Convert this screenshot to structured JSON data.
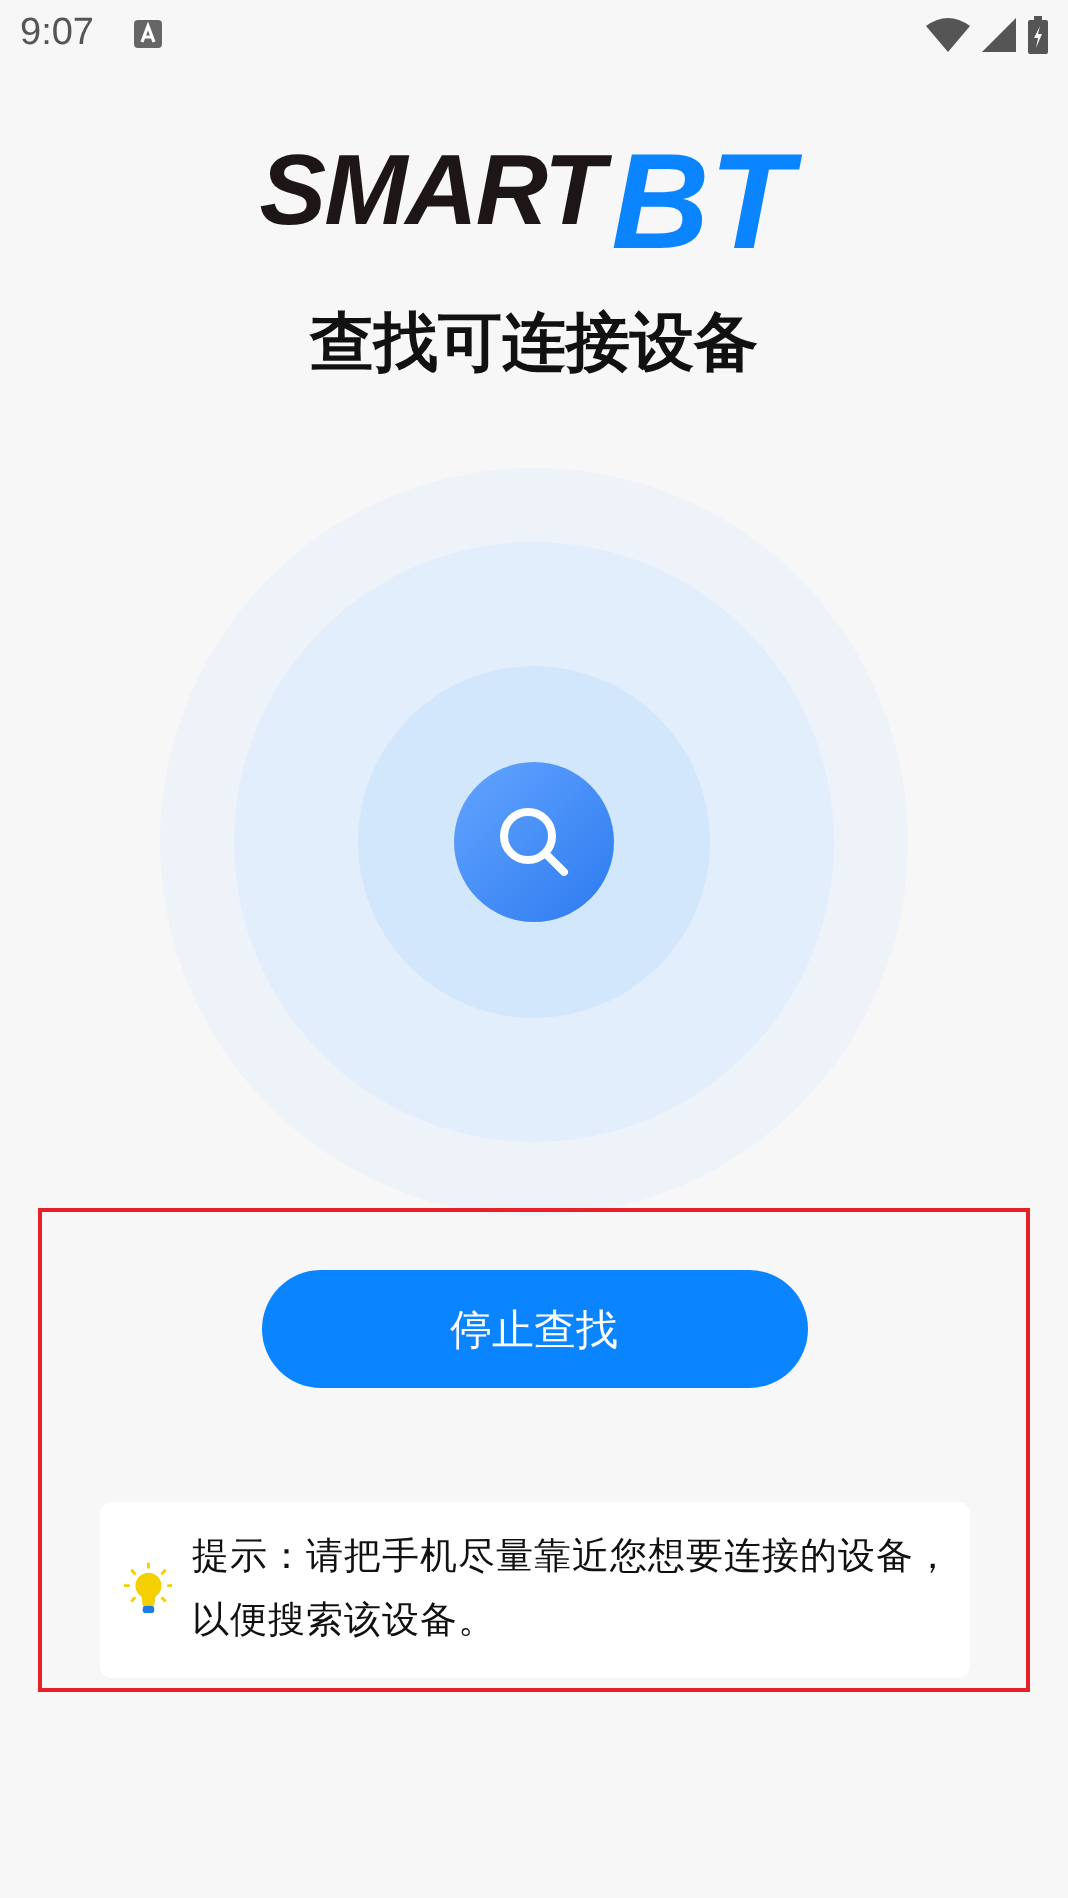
{
  "status_bar": {
    "time": "9:07"
  },
  "logo": {
    "text": "SMART",
    "accent": "BT"
  },
  "title": "查找可连接设备",
  "stop_button": "停止查找",
  "tip": "提示：请把手机尽量靠近您想要连接的设备，以便搜索该设备。"
}
